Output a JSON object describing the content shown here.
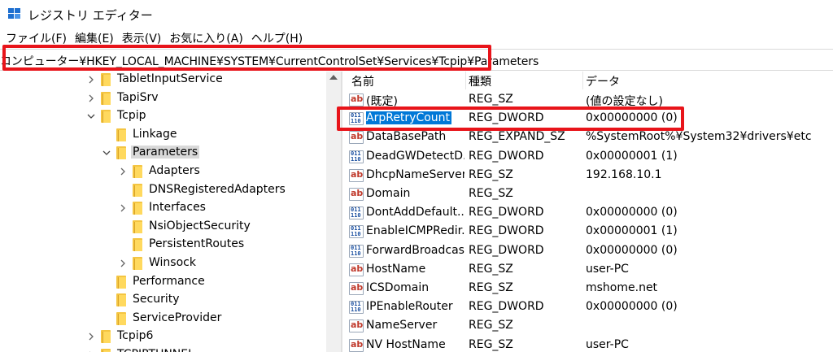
{
  "window": {
    "title": "レジストリ エディター",
    "accent": "#1e6fd0",
    "highlight": "#e8141a"
  },
  "menu": [
    "ファイル(F)",
    "編集(E)",
    "表示(V)",
    "お気に入り(A)",
    "ヘルプ(H)"
  ],
  "address": "コンピューター¥HKEY_LOCAL_MACHINE¥SYSTEM¥CurrentControlSet¥Services¥Tcpip¥Parameters",
  "tree": [
    {
      "label": "TabletInputService",
      "chevron": "right",
      "icon": "folder-icon"
    },
    {
      "label": "TapiSrv",
      "chevron": "right",
      "icon": "folder-icon"
    },
    {
      "label": "Tcpip",
      "chevron": "down",
      "icon": "folder-icon"
    },
    {
      "label": "Linkage",
      "chevron": "none",
      "icon": "folder-icon"
    },
    {
      "label": "Parameters",
      "chevron": "down",
      "icon": "folder-icon",
      "selected": true
    },
    {
      "label": "Adapters",
      "chevron": "right",
      "icon": "folder-icon"
    },
    {
      "label": "DNSRegisteredAdapters",
      "chevron": "none",
      "icon": "folder-icon"
    },
    {
      "label": "Interfaces",
      "chevron": "right",
      "icon": "folder-icon"
    },
    {
      "label": "NsiObjectSecurity",
      "chevron": "none",
      "icon": "folder-icon"
    },
    {
      "label": "PersistentRoutes",
      "chevron": "none",
      "icon": "folder-icon"
    },
    {
      "label": "Winsock",
      "chevron": "right",
      "icon": "folder-icon"
    },
    {
      "label": "Performance",
      "chevron": "none",
      "icon": "folder-icon"
    },
    {
      "label": "Security",
      "chevron": "none",
      "icon": "folder-icon"
    },
    {
      "label": "ServiceProvider",
      "chevron": "none",
      "icon": "folder-icon"
    },
    {
      "label": "Tcpip6",
      "chevron": "right",
      "icon": "folder-icon"
    },
    {
      "label": "TCPIPTUNNEL",
      "chevron": "right",
      "icon": "folder-icon"
    }
  ],
  "list": {
    "columns": [
      "名前",
      "種類",
      "データ"
    ],
    "rows": [
      {
        "name": "(既定)",
        "type": "REG_SZ",
        "data": "(値の設定なし)",
        "icon": "string-value-icon"
      },
      {
        "name": "ArpRetryCount",
        "type": "REG_DWORD",
        "data": "0x00000000 (0)",
        "icon": "dword-value-icon",
        "selected": true
      },
      {
        "name": "DataBasePath",
        "type": "REG_EXPAND_SZ",
        "data": "%SystemRoot%¥System32¥drivers¥etc",
        "icon": "string-value-icon"
      },
      {
        "name": "DeadGWDetectD...",
        "type": "REG_DWORD",
        "data": "0x00000001 (1)",
        "icon": "dword-value-icon"
      },
      {
        "name": "DhcpNameServer",
        "type": "REG_SZ",
        "data": "192.168.10.1",
        "icon": "string-value-icon"
      },
      {
        "name": "Domain",
        "type": "REG_SZ",
        "data": "",
        "icon": "string-value-icon"
      },
      {
        "name": "DontAddDefault...",
        "type": "REG_DWORD",
        "data": "0x00000000 (0)",
        "icon": "dword-value-icon"
      },
      {
        "name": "EnableICMPRedir...",
        "type": "REG_DWORD",
        "data": "0x00000001 (1)",
        "icon": "dword-value-icon"
      },
      {
        "name": "ForwardBroadcas...",
        "type": "REG_DWORD",
        "data": "0x00000000 (0)",
        "icon": "dword-value-icon"
      },
      {
        "name": "HostName",
        "type": "REG_SZ",
        "data": "user-PC",
        "icon": "string-value-icon"
      },
      {
        "name": "ICSDomain",
        "type": "REG_SZ",
        "data": "mshome.net",
        "icon": "string-value-icon"
      },
      {
        "name": "IPEnableRouter",
        "type": "REG_DWORD",
        "data": "0x00000000 (0)",
        "icon": "dword-value-icon"
      },
      {
        "name": "NameServer",
        "type": "REG_SZ",
        "data": "",
        "icon": "string-value-icon"
      },
      {
        "name": "NV HostName",
        "type": "REG_SZ",
        "data": "user-PC",
        "icon": "string-value-icon"
      }
    ]
  }
}
